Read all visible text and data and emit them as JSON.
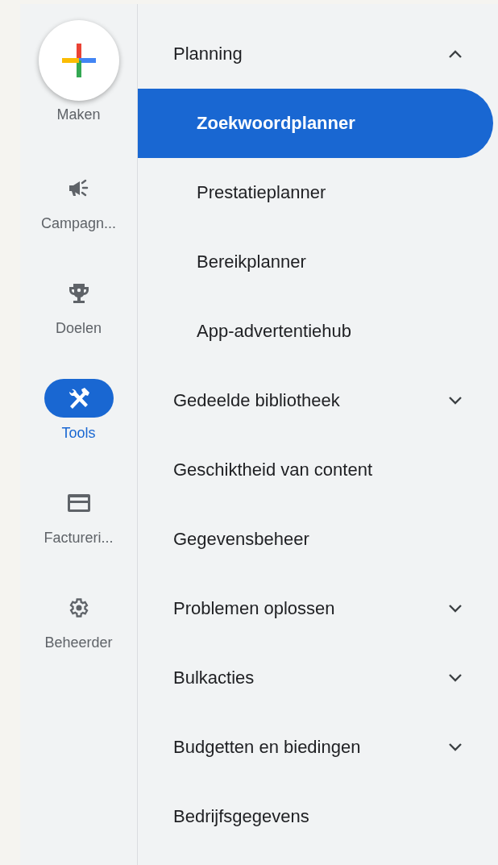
{
  "rail": [
    {
      "kind": "create",
      "label": "Maken"
    },
    {
      "kind": "nav",
      "label": "Campagn...",
      "selected": false
    },
    {
      "kind": "nav",
      "label": "Doelen",
      "selected": false
    },
    {
      "kind": "nav",
      "label": "Tools",
      "selected": true
    },
    {
      "kind": "nav",
      "label": "Factureri...",
      "selected": false
    },
    {
      "kind": "nav",
      "label": "Beheerder",
      "selected": false
    }
  ],
  "menu": [
    {
      "kind": "group",
      "label": "Planning",
      "expanded": true,
      "children": [
        {
          "label": "Zoekwoordplanner",
          "selected": true
        },
        {
          "label": "Prestatieplanner",
          "selected": false
        },
        {
          "label": "Bereikplanner",
          "selected": false
        },
        {
          "label": "App-advertentiehub",
          "selected": false
        }
      ]
    },
    {
      "kind": "group",
      "label": "Gedeelde bibliotheek",
      "expanded": false
    },
    {
      "kind": "link",
      "label": "Geschiktheid van content"
    },
    {
      "kind": "link",
      "label": "Gegevensbeheer"
    },
    {
      "kind": "group",
      "label": "Problemen oplossen",
      "expanded": false
    },
    {
      "kind": "group",
      "label": "Bulkacties",
      "expanded": false
    },
    {
      "kind": "group",
      "label": "Budgetten en biedingen",
      "expanded": false
    },
    {
      "kind": "link",
      "label": "Bedrijfsgegevens"
    }
  ]
}
